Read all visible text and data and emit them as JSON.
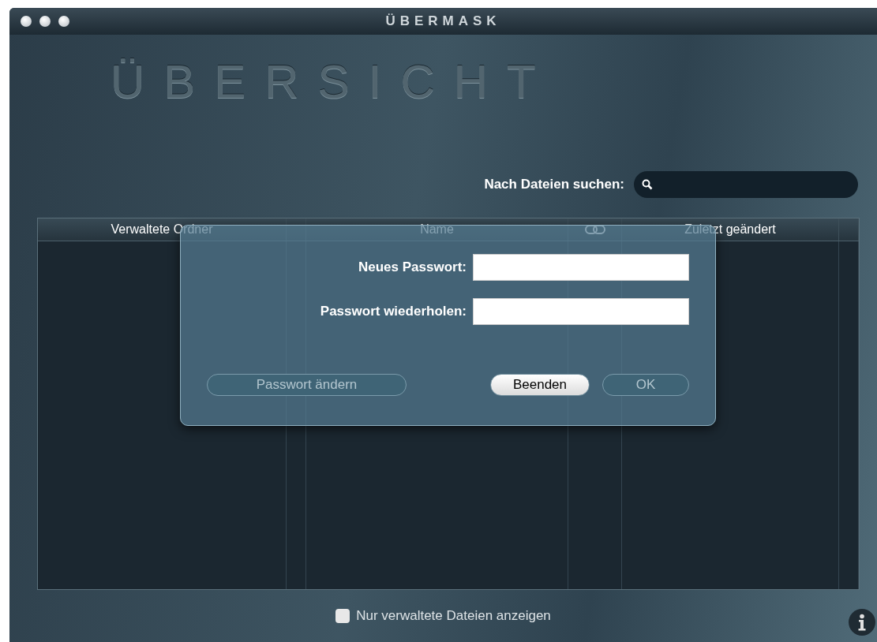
{
  "window": {
    "title": "ÜBERMASK"
  },
  "heading": "ÜBERSICHT",
  "search": {
    "label": "Nach Dateien suchen:"
  },
  "table": {
    "columns": [
      {
        "kind": "text",
        "label": "Verwaltete Ordner"
      },
      {
        "kind": "blank"
      },
      {
        "kind": "text",
        "label": "Name"
      },
      {
        "kind": "icon"
      },
      {
        "kind": "text",
        "label": "Zuletzt geändert"
      },
      {
        "kind": "blank"
      }
    ]
  },
  "filter": {
    "label": "Nur verwaltete Dateien anzeigen",
    "checked": false
  },
  "dialog": {
    "fields": [
      {
        "label": "Neues Passwort:"
      },
      {
        "label": "Passwort wiederholen:"
      }
    ],
    "buttons": [
      {
        "label": "Passwort ändern",
        "disabled": true
      },
      {
        "label": "Beenden",
        "disabled": false
      },
      {
        "label": "OK",
        "disabled": true
      }
    ]
  }
}
